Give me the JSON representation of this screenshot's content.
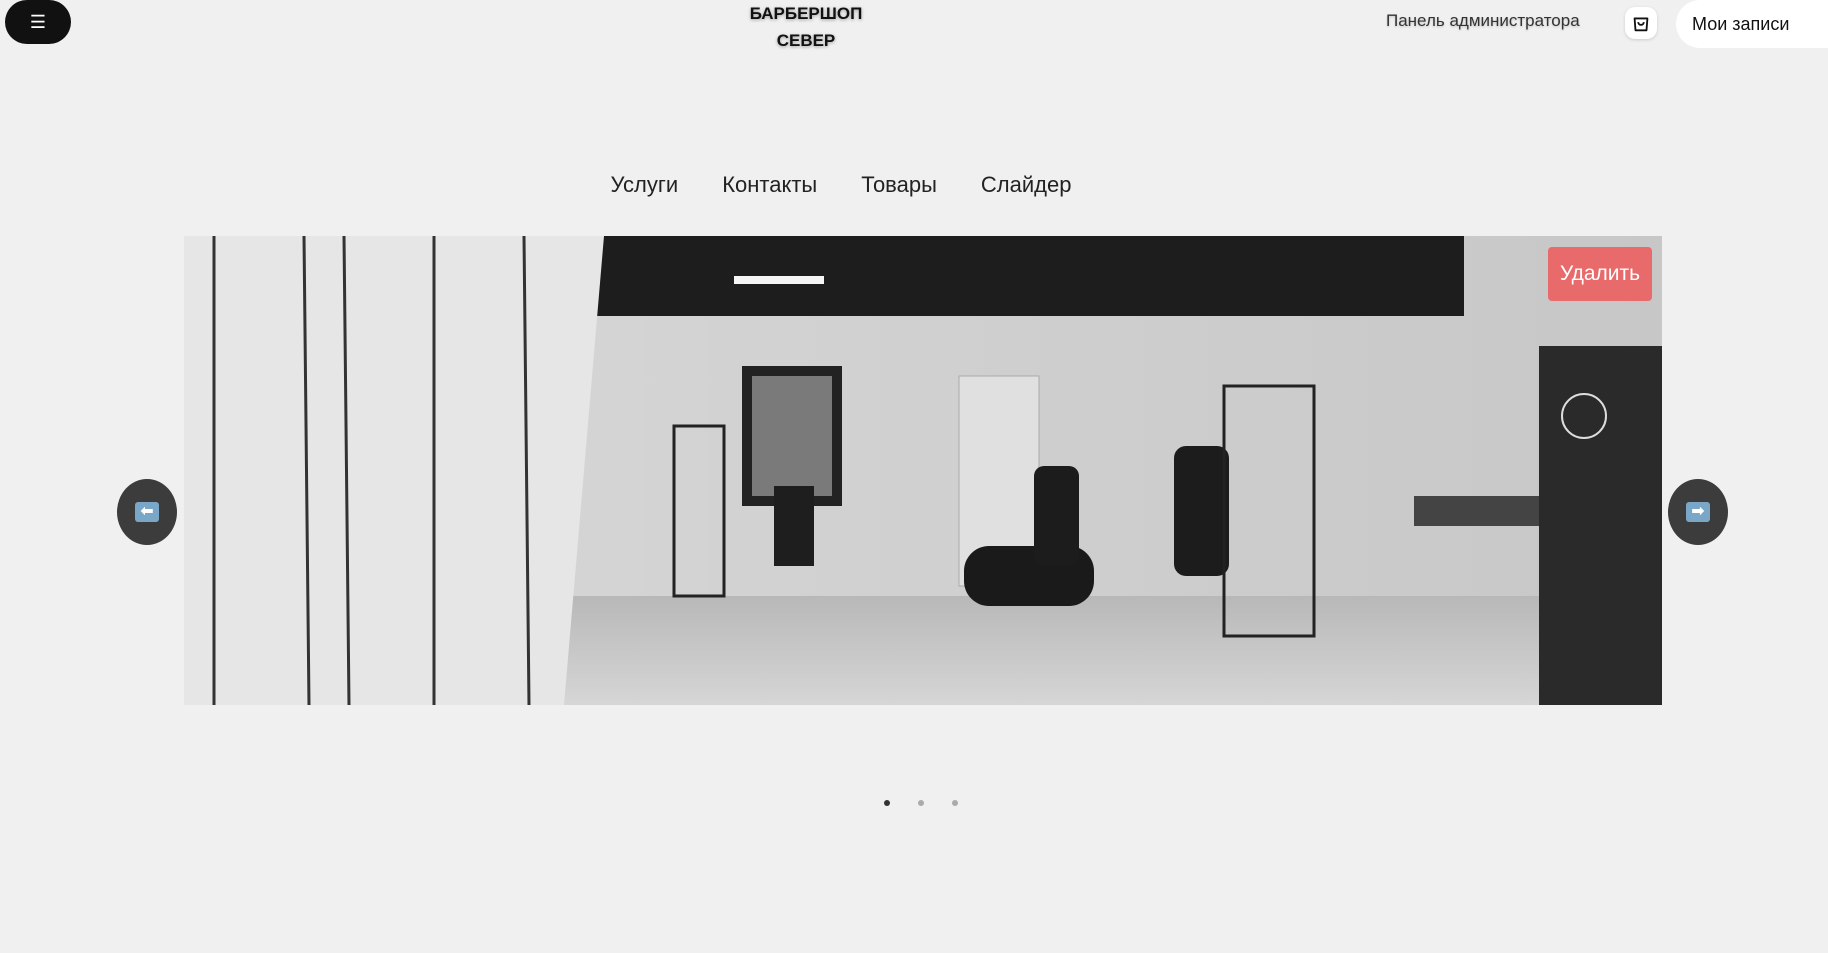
{
  "header": {
    "menu_icon": "☰",
    "logo_line1": "БАРБЕРШОП",
    "logo_line2": "СЕВЕР",
    "admin_link": "Панель администратора",
    "cart_icon": "shopping-bag-icon",
    "my_records": "Мои записи"
  },
  "nav": {
    "items": [
      "Услуги",
      "Контакты",
      "Товары",
      "Слайдер"
    ]
  },
  "slider": {
    "image_alt": "barbershop interior photo",
    "delete_label": "Удалить",
    "prev_arrow": "⬅",
    "next_arrow": "➡",
    "slide_count": 3,
    "active_index": 0
  },
  "colors": {
    "background": "#f0f0f0",
    "delete_button": "#e86a6a",
    "arrow_button": "#3c3c3c",
    "menu_button": "#111111"
  }
}
